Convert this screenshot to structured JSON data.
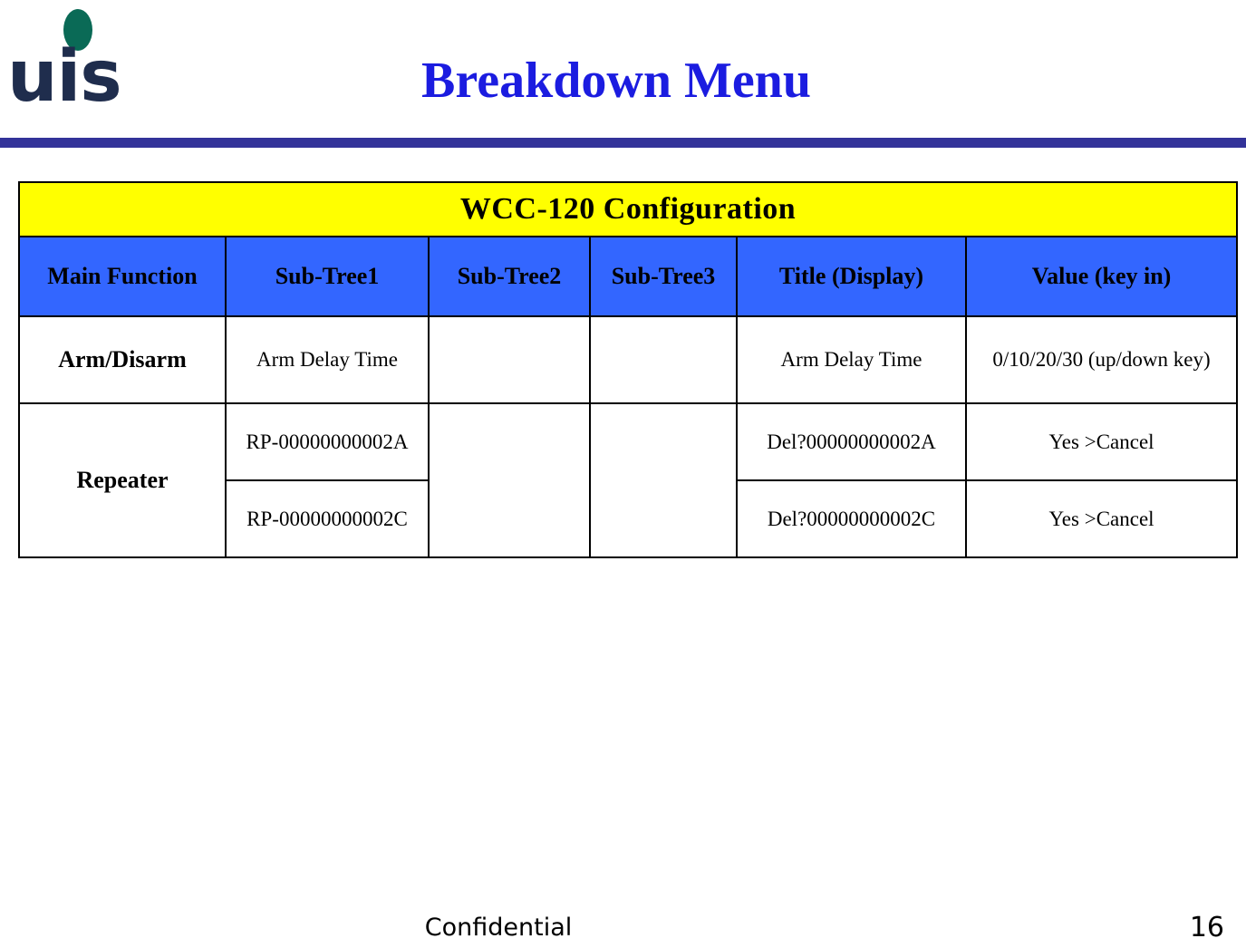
{
  "slide": {
    "title": "Breakdown Menu",
    "logo": {
      "name": "uis-logo",
      "text": "uis",
      "dot_color": "#0a6a56",
      "text_color": "#1f2d4d"
    },
    "rule_color": "#333399",
    "title_color": "#1b1ce0"
  },
  "table": {
    "banner": "WCC-120 Configuration",
    "banner_bg": "#ffff00",
    "header_bg": "#3366ff",
    "columns": [
      "Main Function",
      "Sub-Tree1",
      "Sub-Tree2",
      "Sub-Tree3",
      "Title (Display)",
      "Value (key in)"
    ],
    "rows": [
      {
        "main_function": "Arm/Disarm",
        "sub_tree1": "Arm Delay Time",
        "sub_tree2": "",
        "sub_tree3": "",
        "title_display": "Arm Delay Time",
        "value_key_in": "0/10/20/30 (up/down key)"
      },
      {
        "main_function": "Repeater",
        "sub_tree1": "RP-00000000002A",
        "sub_tree2": "",
        "sub_tree3": "",
        "title_display": "Del?00000000002A",
        "value_key_in": "Yes >Cancel"
      },
      {
        "main_function": "",
        "sub_tree1": "RP-00000000002C",
        "sub_tree2": "",
        "sub_tree3": "",
        "title_display": "Del?00000000002C",
        "value_key_in": "Yes >Cancel"
      }
    ]
  },
  "footer": {
    "confidential": "Confidential",
    "page_number": "16"
  }
}
